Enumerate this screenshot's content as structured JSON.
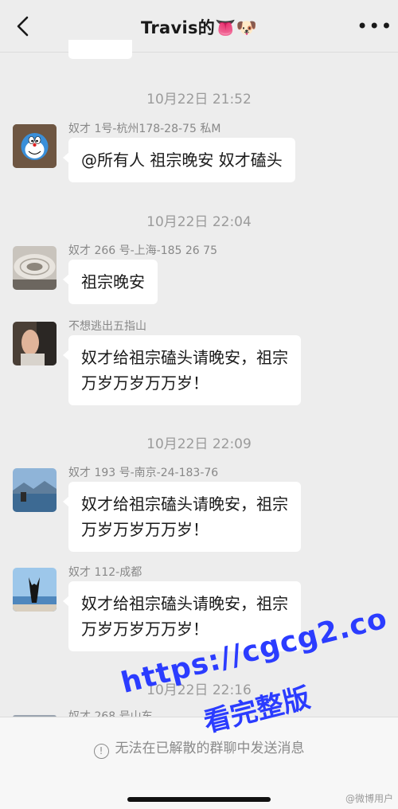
{
  "header": {
    "title": "Travis的👅🐶",
    "more_label": "•••"
  },
  "timestamps": [
    "10月22日 21:52",
    "10月22日 22:04",
    "10月22日 22:09",
    "10月22日 22:16"
  ],
  "messages": [
    {
      "sender": "奴才 1号-杭州178-28-75 私M",
      "text": "@所有人 祖宗晚安 奴才磕头",
      "avatar": "doraemon-avatar"
    },
    {
      "sender": "奴才 266 号-上海-185 26 75",
      "text": "祖宗晚安",
      "avatar": "ceiling-photo-avatar"
    },
    {
      "sender": "不想逃出五指山",
      "text": "奴才给祖宗磕头请晚安，祖宗\n万岁万岁万万岁！",
      "avatar": "person-photo-avatar"
    },
    {
      "sender": "奴才 193 号-南京-24-183-76",
      "text": "奴才给祖宗磕头请晚安，祖宗\n万岁万岁万万岁！",
      "avatar": "lake-photo-avatar"
    },
    {
      "sender": "奴才 112-成都",
      "text": "奴才给祖宗磕头请晚安，祖宗\n万岁万岁万万岁！",
      "avatar": "beach-photo-avatar"
    }
  ],
  "partial_sender": "奴才 268 号山东",
  "notice": "无法在已解散的群聊中发送消息",
  "watermark": {
    "url": "https://cgcg2.co",
    "text": "看完整版"
  },
  "weibo_mark": "@微博用户"
}
